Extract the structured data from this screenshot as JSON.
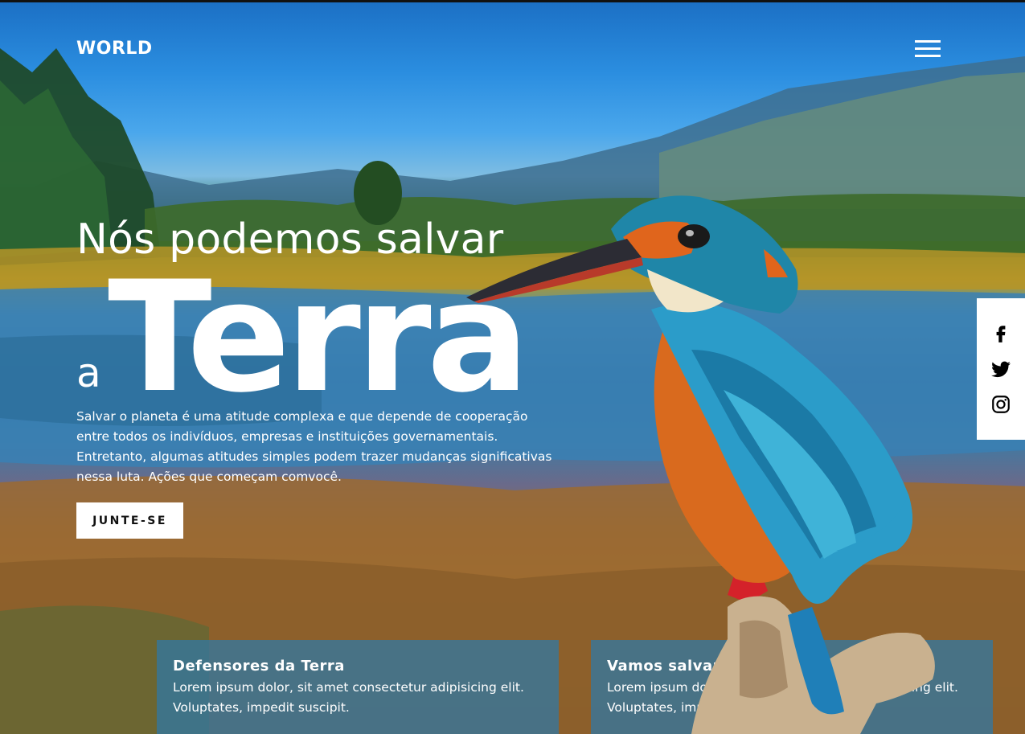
{
  "header": {
    "logo": "WORLD",
    "menu_icon": "hamburger-menu-icon"
  },
  "hero": {
    "line1": "Nós podemos salvar",
    "line2_small": "a",
    "line2_big": "Terra",
    "description": "Salvar o planeta é uma atitude complexa e que depende de cooperação entre todos os indivíduos, empresas e instituições governamentais. Entretanto, algumas atitudes simples podem trazer mudanças significativas nessa luta. Ações que começam comvocê.",
    "cta_label": "JUNTE-SE"
  },
  "social": [
    {
      "name": "facebook-icon"
    },
    {
      "name": "twitter-icon"
    },
    {
      "name": "instagram-icon"
    }
  ],
  "cards": [
    {
      "title": "Defensores da Terra",
      "text": "Lorem ipsum dolor, sit amet consectetur adipisicing elit. Voluptates, impedit suscipit."
    },
    {
      "title": "Vamos salvar",
      "text": "Lorem ipsum dolor, sit amet consectetur adipisicing elit. Voluptates, impedit suscipit."
    }
  ],
  "colors": {
    "card_bg": "#2e78a8",
    "text": "#ffffff",
    "cta_bg": "#ffffff"
  }
}
